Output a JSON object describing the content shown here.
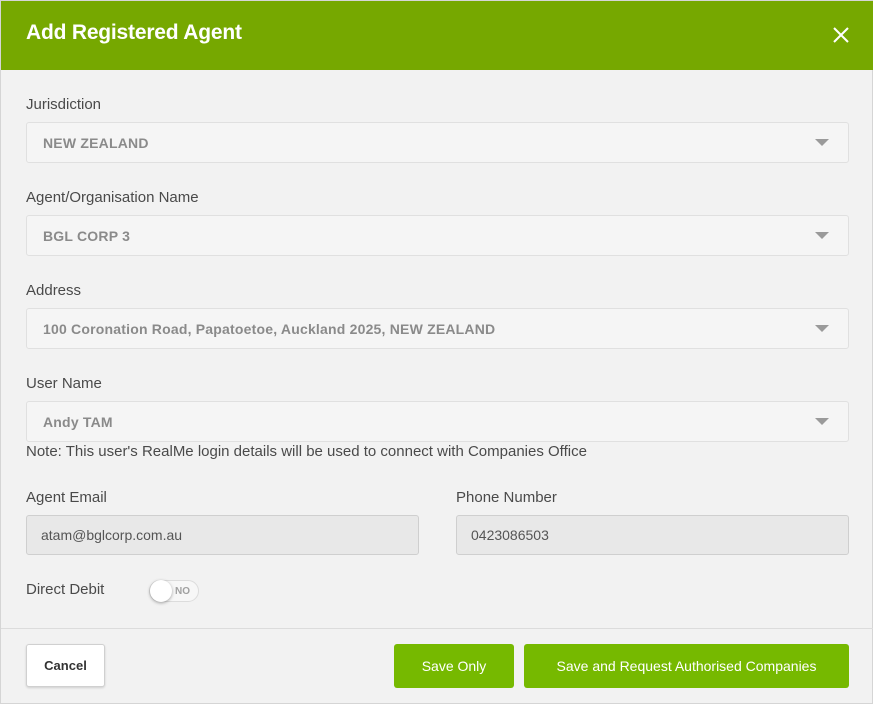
{
  "dialog": {
    "title": "Add Registered Agent"
  },
  "colors": {
    "header": "#76a800",
    "button": "#76b900"
  },
  "icons": {
    "close": "close-icon",
    "dropdown": "caret-down-icon"
  },
  "fields": {
    "jurisdiction": {
      "label": "Jurisdiction",
      "value": "NEW ZEALAND"
    },
    "agent_name": {
      "label": "Agent/Organisation Name",
      "value": "BGL CORP 3"
    },
    "address": {
      "label": "Address",
      "value": "100 Coronation Road, Papatoetoe, Auckland 2025, NEW ZEALAND"
    },
    "user_name": {
      "label": "User Name",
      "value": "Andy TAM"
    },
    "note": "Note: This user's RealMe login details will be used to connect with Companies Office",
    "agent_email": {
      "label": "Agent Email",
      "value": "atam@bglcorp.com.au"
    },
    "phone": {
      "label": "Phone Number",
      "value": "0423086503"
    },
    "direct_debit": {
      "label": "Direct Debit",
      "state": "NO"
    }
  },
  "footer": {
    "cancel": "Cancel",
    "save_only": "Save Only",
    "save_request": "Save and Request Authorised Companies"
  }
}
